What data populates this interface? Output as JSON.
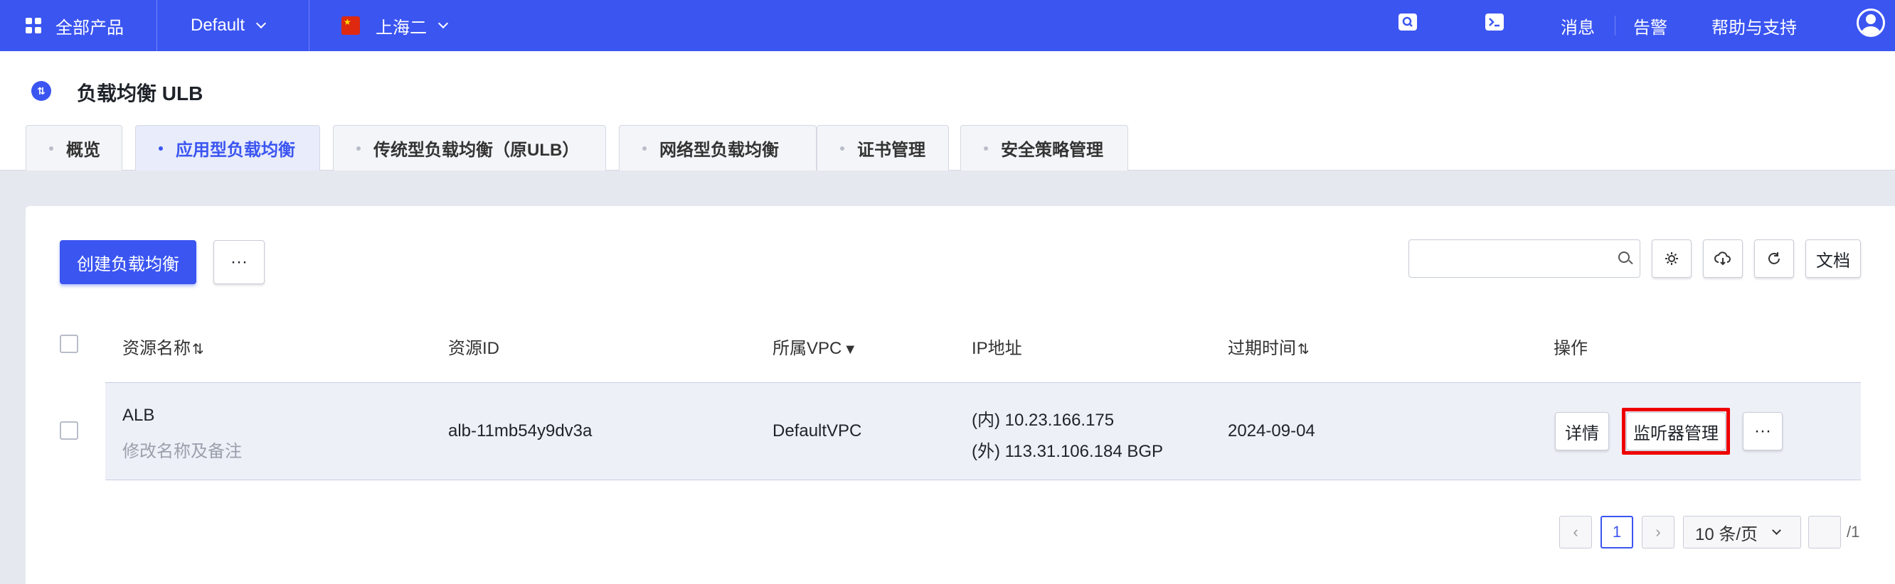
{
  "topbar": {
    "all_products": "全部产品",
    "project": "Default",
    "region": "上海二",
    "messages": "消息",
    "alerts": "告警",
    "help": "帮助与支持"
  },
  "header": {
    "title": "负载均衡 ULB",
    "tabs": [
      {
        "label": "概览"
      },
      {
        "label": "应用型负载均衡"
      },
      {
        "label": "传统型负载均衡（原ULB）"
      },
      {
        "label": "网络型负载均衡"
      },
      {
        "label": "证书管理"
      },
      {
        "label": "安全策略管理"
      }
    ],
    "active_tab": "应用型负载均衡"
  },
  "toolbar": {
    "create_label": "创建负载均衡",
    "more_label": "···",
    "search_placeholder": "",
    "docs_label": "文档"
  },
  "table": {
    "columns": [
      "资源名称",
      "资源ID",
      "所属VPC",
      "IP地址",
      "过期时间",
      "操作"
    ],
    "rows": [
      {
        "name": "ALB",
        "remark_link": "修改名称及备注",
        "id": "alb-11mb54y9dv3a",
        "vpc": "DefaultVPC",
        "ip_internal": "(内) 10.23.166.175",
        "ip_external": "(外) 113.31.106.184 BGP",
        "expire": "2024-09-04",
        "actions": {
          "detail": "详情",
          "listener": "监听器管理",
          "more": "···"
        }
      }
    ]
  },
  "pagination": {
    "prev": "‹",
    "current": "1",
    "next": "›",
    "page_size": "10 条/页",
    "total": "/1"
  },
  "colors": {
    "brand": "#3b55f1",
    "highlight": "#e00000"
  }
}
